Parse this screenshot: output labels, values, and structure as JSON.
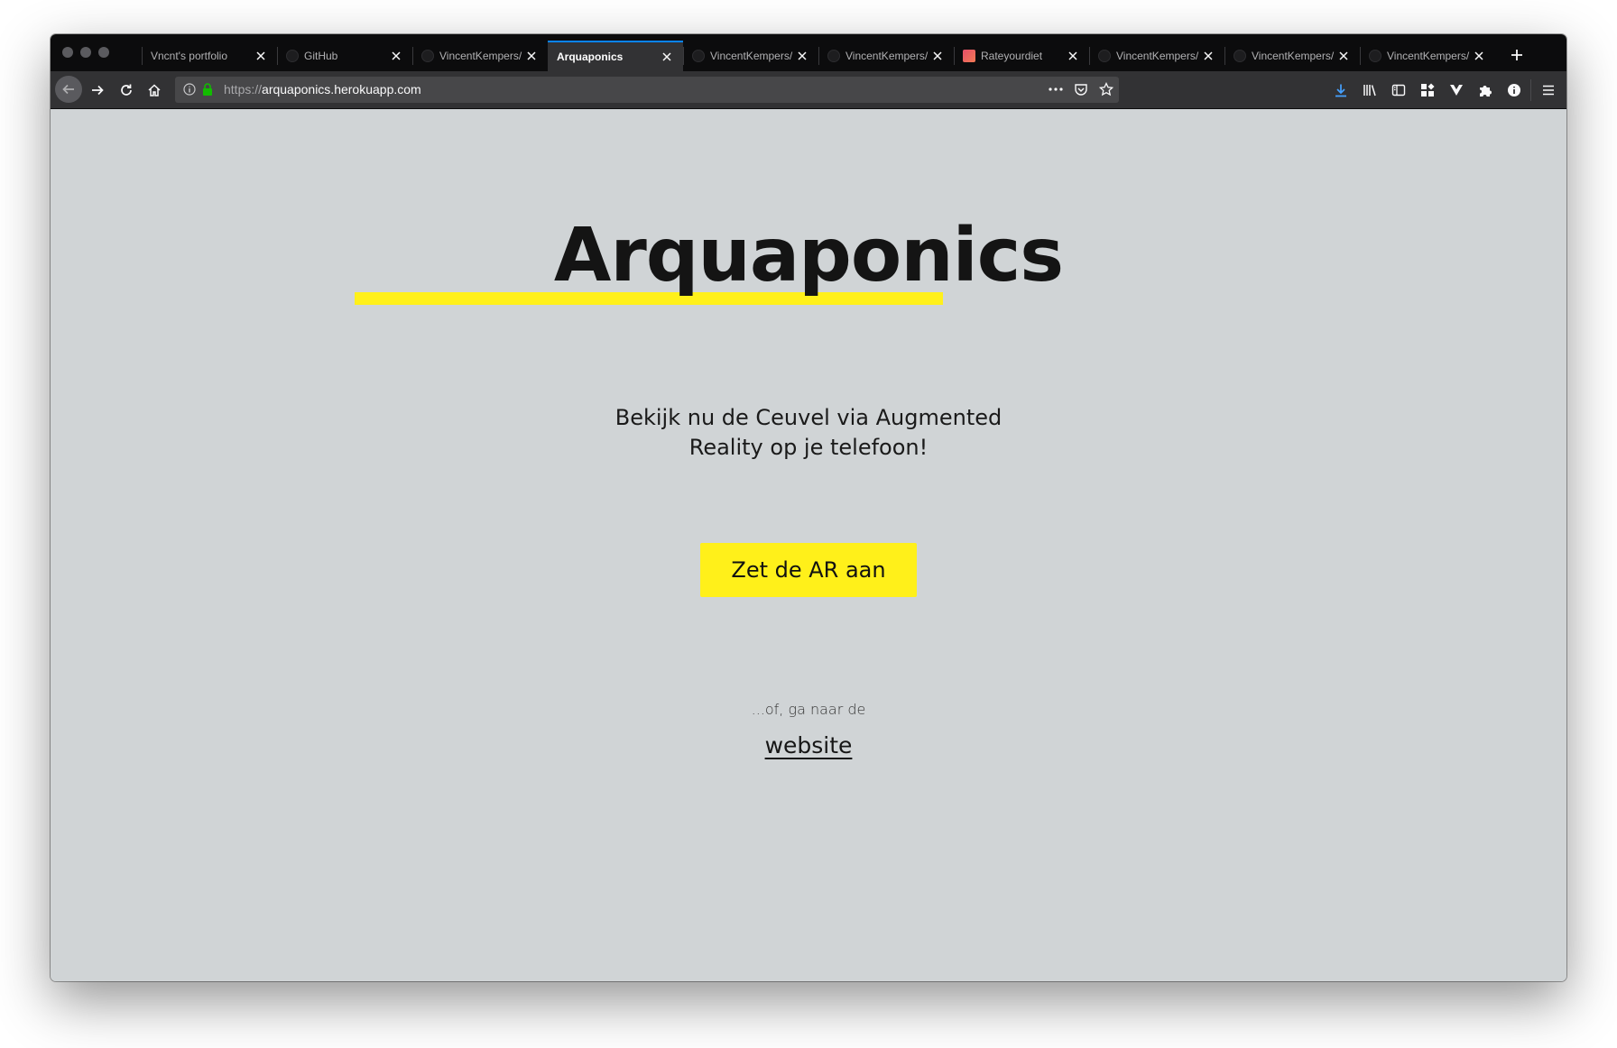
{
  "browser": {
    "tabs": [
      {
        "title": "Vncnt's portfolio",
        "favicon": "none",
        "active": false
      },
      {
        "title": "GitHub",
        "favicon": "github-icon",
        "active": false
      },
      {
        "title": "VincentKempers/",
        "favicon": "github-icon",
        "active": false
      },
      {
        "title": "Arquaponics",
        "favicon": "none",
        "active": true
      },
      {
        "title": "VincentKempers/",
        "favicon": "github-icon",
        "active": false
      },
      {
        "title": "VincentKempers/",
        "favicon": "github-icon",
        "active": false
      },
      {
        "title": "Rateyourdiet",
        "favicon": "rateyourdiet-icon",
        "active": false
      },
      {
        "title": "VincentKempers/",
        "favicon": "github-icon",
        "active": false
      },
      {
        "title": "VincentKempers/",
        "favicon": "github-icon",
        "active": false
      },
      {
        "title": "VincentKempers/",
        "favicon": "github-icon",
        "active": false
      }
    ],
    "url": {
      "scheme": "https://",
      "host": "arquaponics.herokuapp.com"
    },
    "accent_color": "#0a84ff"
  },
  "page": {
    "title": "Arquaponics",
    "tagline": "Bekijk nu de Ceuvel via Augmented Reality op je telefoon!",
    "cta_label": "Zet de AR aan",
    "alt_text": "...of, ga naar de",
    "website_link": "website",
    "colors": {
      "background": "#d0d4d6",
      "accent_yellow": "#fff01a",
      "text": "#141414"
    }
  }
}
